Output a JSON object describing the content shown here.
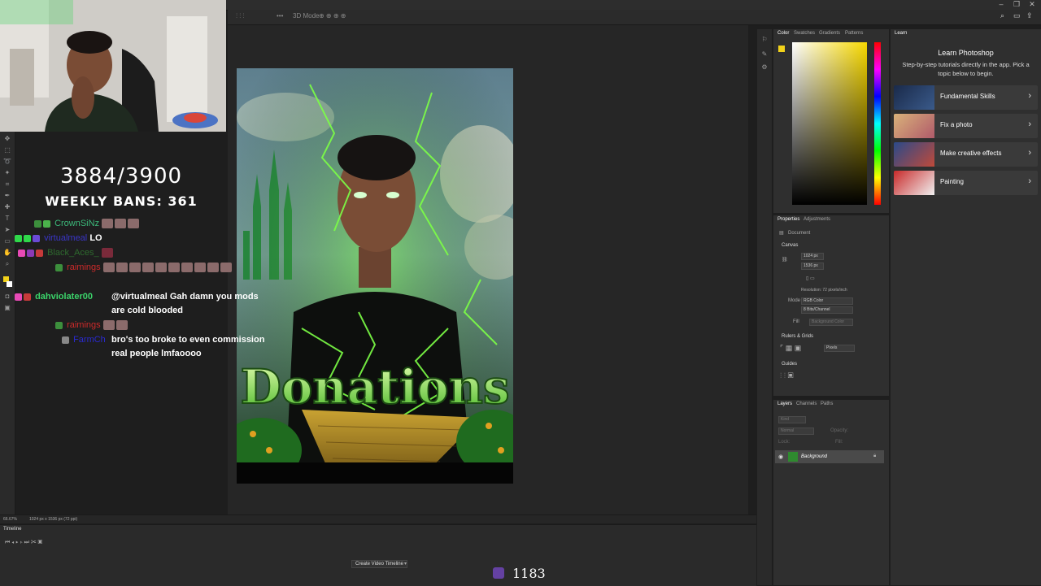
{
  "stream": {
    "goal_counter": "3884/3900",
    "weekly_bans": "WEEKLY BANS: 361",
    "viewer_count": "1183",
    "chat": [
      {
        "user": "CrownSiNz",
        "user_color": "#3cb97a",
        "text": ""
      },
      {
        "user": "virtualmeal",
        "user_color": "#3a35c8",
        "text": "LO"
      },
      {
        "user": "Black_Aces_",
        "user_color": "#2e6a2e",
        "text": ""
      },
      {
        "user": "raimings",
        "user_color": "#cc2a2a",
        "text": ""
      },
      {
        "user": "dahviolater00",
        "user_color": "#3bd36a",
        "text": "@virtualmeal Gah damn you mods are cold blooded"
      },
      {
        "user": "raimings",
        "user_color": "#cc2a2a",
        "text": ""
      },
      {
        "user": "FarmCh",
        "user_color": "#2a2ad0",
        "text": "bro's too broke to even commission real people lmfaoooo"
      }
    ]
  },
  "photoshop": {
    "doc_title": "Donations",
    "status_zoom": "66.67%",
    "status_info": "1024 px x 1536 px (72 ppi)",
    "timeline_tab": "Timeline",
    "create_video_timeline": "Create Video Timeline",
    "color_tabs": [
      "Color",
      "Swatches",
      "Gradients",
      "Patterns"
    ],
    "learn_tab": "Learn",
    "learn_title": "Learn Photoshop",
    "learn_subtitle": "Step-by-step tutorials directly in the app. Pick a topic below to begin.",
    "learn_items": [
      {
        "label": "Fundamental Skills"
      },
      {
        "label": "Fix a photo"
      },
      {
        "label": "Make creative effects"
      },
      {
        "label": "Painting"
      }
    ],
    "properties_tabs": [
      "Properties",
      "Adjustments"
    ],
    "properties": {
      "document": "Document",
      "canvas": "Canvas",
      "width": "1024 px",
      "height": "1536 px",
      "resolution": "Resolution: 72 pixels/inch",
      "mode_label": "Mode",
      "mode": "RGB Color",
      "bits": "8 Bits/Channel",
      "fill_label": "Fill",
      "fill": "Background Color",
      "rulers": "Rulers & Grids",
      "units": "Pixels",
      "guides": "Guides"
    },
    "layers_tabs": [
      "Layers",
      "Channels",
      "Paths"
    ],
    "layers": {
      "kind": "Kind",
      "blend": "Normal",
      "opacity": "Opacity:",
      "lock": "Lock:",
      "fill": "Fill:",
      "layer_name": "Background"
    }
  }
}
